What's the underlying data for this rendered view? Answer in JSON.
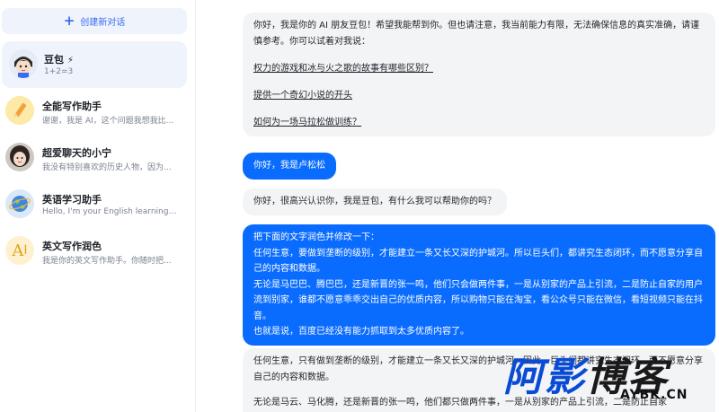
{
  "sidebar": {
    "new_chat_label": "创建新对话",
    "items": [
      {
        "title": "豆包",
        "badge": "⚡",
        "sub": "1+2=3",
        "avatar_icon": "doubao-avatar-icon"
      },
      {
        "title": "全能写作助手",
        "sub": "谢谢，我是 AI，这个问题我想我比...",
        "avatar_icon": "pencil-icon"
      },
      {
        "title": "超爱聊天的小宁",
        "sub": "我没有特别喜欢的历史人物，因为...",
        "avatar_icon": "girl-avatar-icon"
      },
      {
        "title": "英语学习助手",
        "sub": "Hello, I'm your English learning ass...",
        "avatar_icon": "globe-icon"
      },
      {
        "title": "英文写作润色",
        "sub": "我是你的英文写作助手。你随时把...",
        "avatar_icon": "ai-text-icon",
        "avatar_text": "A"
      }
    ]
  },
  "chat": {
    "msg1": {
      "intro": "你好，我是你的 AI 朋友豆包！希望我能帮到你。但也请注意，我当前能力有限，无法确保信息的真实准确，请谨慎参考。你可以试着对我说：",
      "suggestions": [
        "权力的游戏和冰与火之歌的故事有哪些区别？",
        "提供一个奇幻小说的开头",
        "如何为一场马拉松做训练？"
      ]
    },
    "msg2": "你好，我是卢松松",
    "msg3": "你好，很高兴认识你，我是豆包，有什么我可以帮助你的吗？",
    "msg4": [
      "把下面的文字润色并修改一下：",
      "任何生意，要做到垄断的级别，才能建立一条又长又深的护城河。所以巨头们，都讲究生态闭环，而不愿意分享自己的内容和数据。",
      "无论是马巴巴、腾巴巴，还是新晋的张一鸣，他们只会做两件事，一是从别家的产品上引流，二是防止自家的用户流到别家，谁都不愿意乖乖交出自己的优质内容，所以购物只能在淘宝，看公众号只能在微信，看短视频只能在抖音。",
      "也就是说，百度已经没有能力抓取到太多优质内容了。"
    ],
    "msg5": [
      "任何生意，只有做到垄断的级别，才能建立一条又长又深的护城河。因此，巨头们都讲究生态闭环，而不愿意分享自己的内容和数据。",
      "无论是马云、马化腾，还是新晋的张一鸣，他们都只做两件事，一是从别家的产品上引流，二是防止自家"
    ]
  },
  "watermark": {
    "big_a": "阿",
    "big_b": "影",
    "big_c": "博客",
    "small": "AYBK.CN"
  },
  "colors": {
    "accent": "#0a6cff",
    "sidebar_active": "#eef3fc",
    "bot_bubble": "#f3f4f6"
  }
}
